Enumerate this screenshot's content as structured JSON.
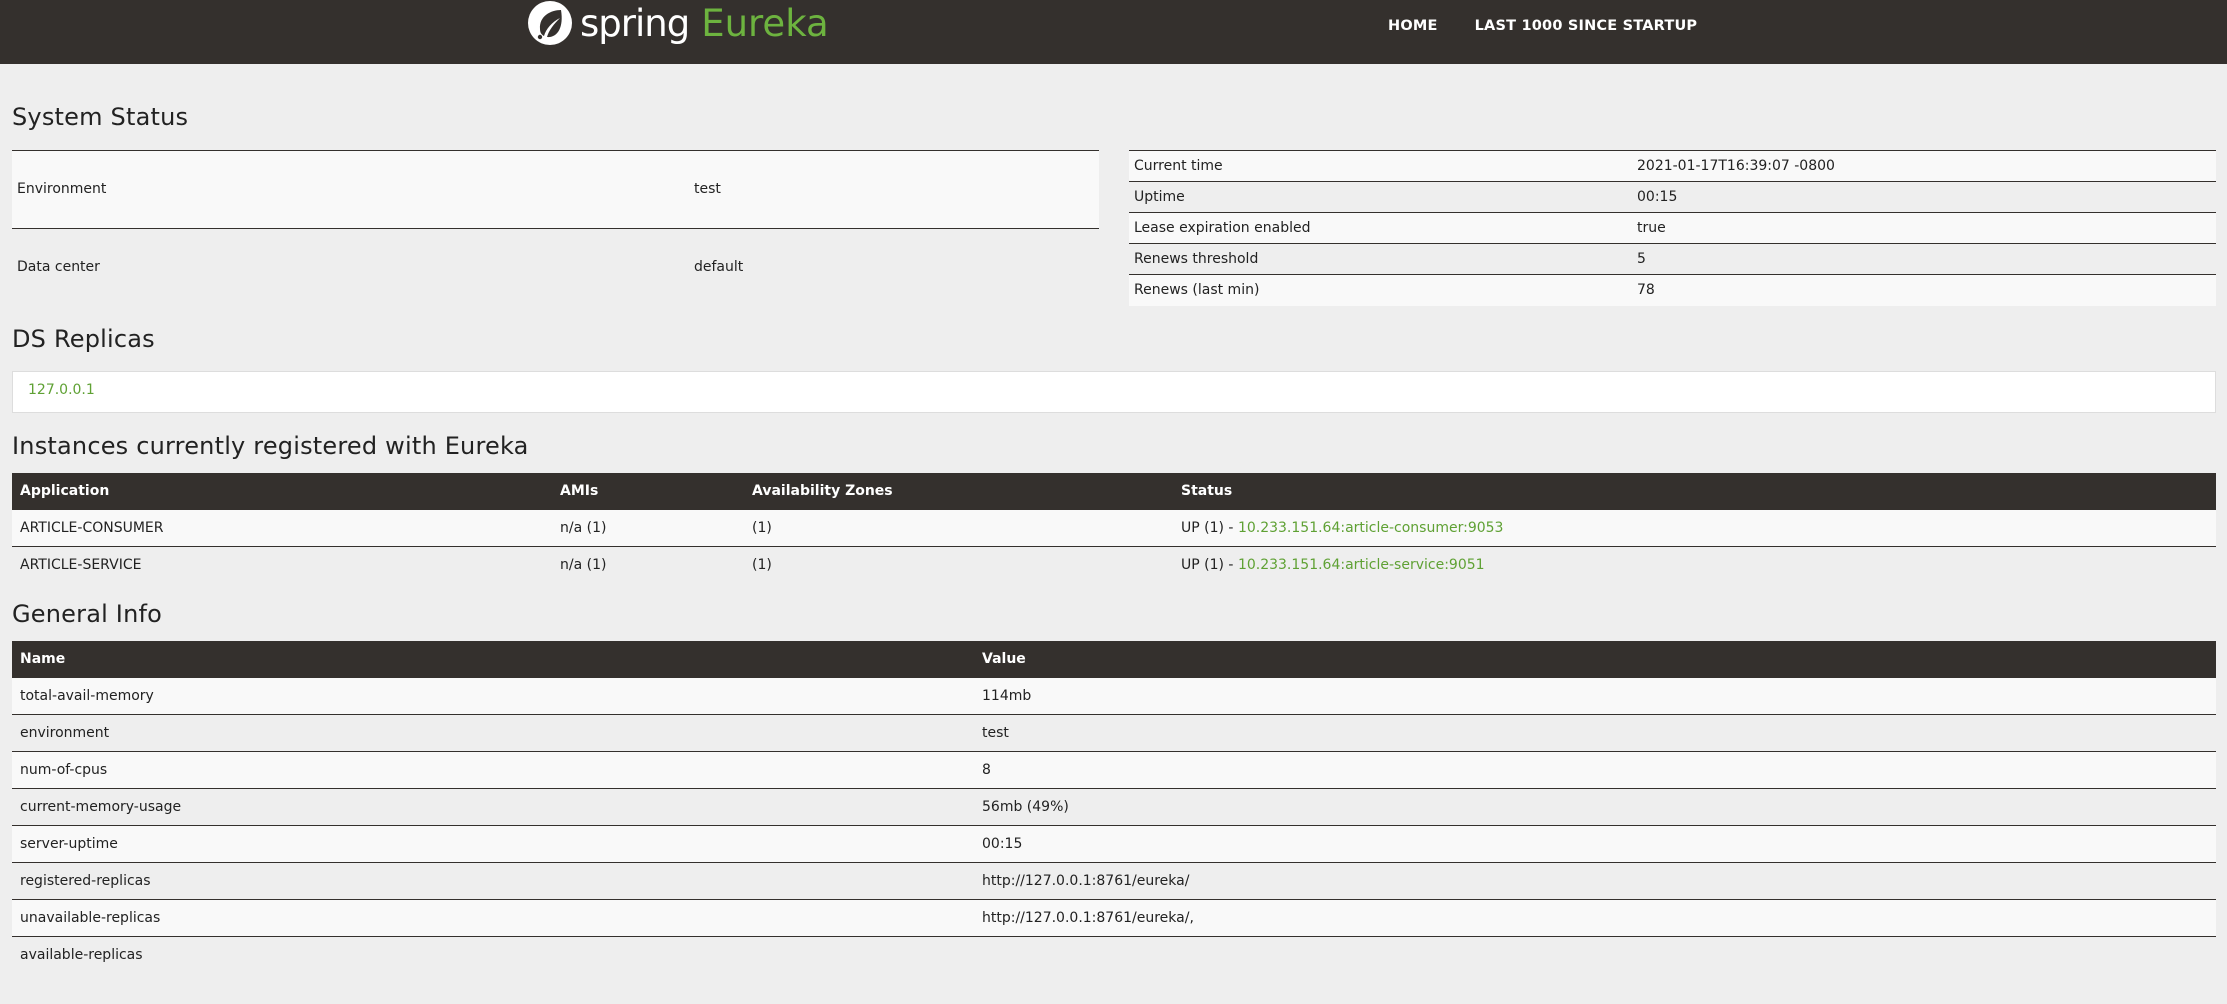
{
  "navbar": {
    "brand_spring": "spring",
    "brand_eureka": "Eureka",
    "links": [
      "HOME",
      "LAST 1000 SINCE STARTUP"
    ]
  },
  "system_status": {
    "title": "System Status",
    "left": [
      {
        "label": "Environment",
        "value": "test"
      },
      {
        "label": "Data center",
        "value": "default"
      }
    ],
    "right": [
      {
        "label": "Current time",
        "value": "2021-01-17T16:39:07 -0800"
      },
      {
        "label": "Uptime",
        "value": "00:15"
      },
      {
        "label": "Lease expiration enabled",
        "value": "true"
      },
      {
        "label": "Renews threshold",
        "value": "5"
      },
      {
        "label": "Renews (last min)",
        "value": "78"
      }
    ]
  },
  "ds_replicas": {
    "title": "DS Replicas",
    "items": [
      "127.0.0.1"
    ]
  },
  "instances": {
    "title": "Instances currently registered with Eureka",
    "headers": [
      "Application",
      "AMIs",
      "Availability Zones",
      "Status"
    ],
    "rows": [
      {
        "application": "ARTICLE-CONSUMER",
        "amis": "n/a (1)",
        "zones": "(1)",
        "status_prefix": "UP (1) - ",
        "instance": "10.233.151.64:article-consumer:9053"
      },
      {
        "application": "ARTICLE-SERVICE",
        "amis": "n/a (1)",
        "zones": "(1)",
        "status_prefix": "UP (1) - ",
        "instance": "10.233.151.64:article-service:9051"
      }
    ]
  },
  "general_info": {
    "title": "General Info",
    "headers": [
      "Name",
      "Value"
    ],
    "rows": [
      {
        "name": "total-avail-memory",
        "value": "114mb"
      },
      {
        "name": "environment",
        "value": "test"
      },
      {
        "name": "num-of-cpus",
        "value": "8"
      },
      {
        "name": "current-memory-usage",
        "value": "56mb (49%)"
      },
      {
        "name": "server-uptime",
        "value": "00:15"
      },
      {
        "name": "registered-replicas",
        "value": "http://127.0.0.1:8761/eureka/"
      },
      {
        "name": "unavailable-replicas",
        "value": "http://127.0.0.1:8761/eureka/,"
      },
      {
        "name": "available-replicas",
        "value": ""
      }
    ]
  },
  "colors": {
    "navbar_bg": "#34302d",
    "accent_green": "#6db33f",
    "link_green": "#5fa134",
    "page_bg": "#eeeeee"
  },
  "icons": {
    "logo": "spring-leaf-icon"
  }
}
